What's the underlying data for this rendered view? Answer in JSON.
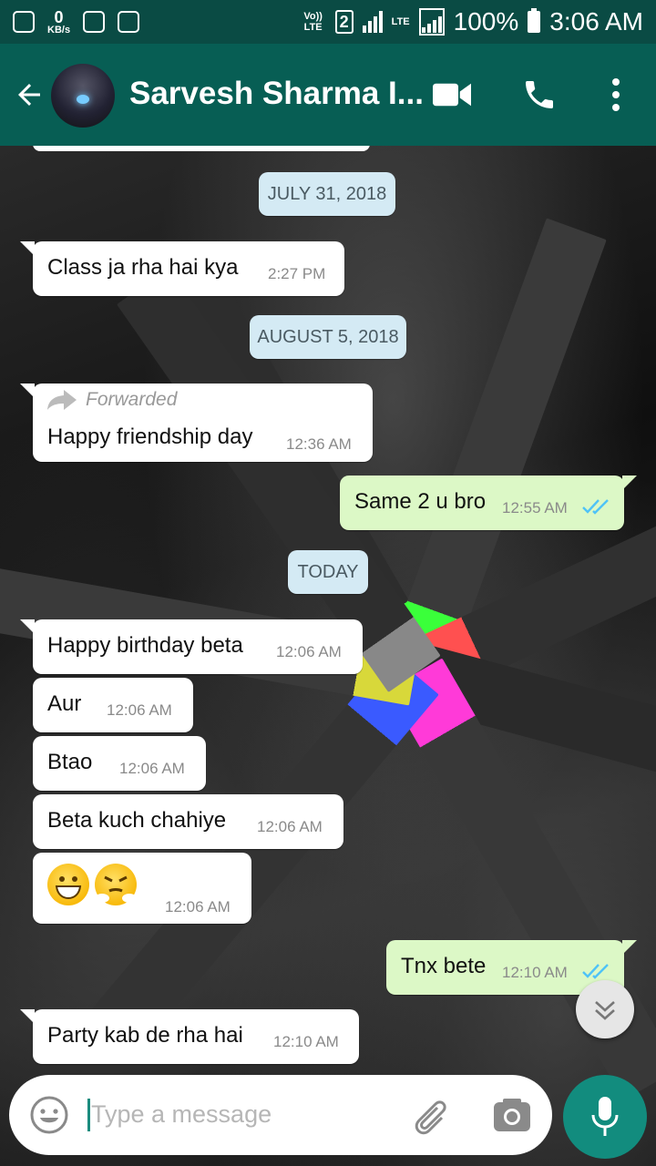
{
  "status_bar": {
    "data_speed_value": "0",
    "data_speed_unit": "KB/s",
    "volte": "Vo)) LTE",
    "sim": "2",
    "lte": "LTE",
    "battery": "100%",
    "time": "3:06 AM"
  },
  "header": {
    "contact_name": "Sarvesh Sharma I...",
    "back_icon": "arrow-left-icon",
    "video_icon": "videocam-icon",
    "call_icon": "phone-icon",
    "menu_icon": "more-vert-icon"
  },
  "messages": [
    {
      "type": "date",
      "text": "JULY 31, 2018"
    },
    {
      "type": "in",
      "text": "Class ja rha hai kya",
      "time": "2:27 PM"
    },
    {
      "type": "date",
      "text": "AUGUST 5, 2018"
    },
    {
      "type": "in",
      "forwarded_label": "Forwarded",
      "text": "Happy friendship day",
      "time": "12:36 AM"
    },
    {
      "type": "out",
      "text": "Same 2 u bro",
      "time": "12:55 AM",
      "status": "read"
    },
    {
      "type": "date",
      "text": "TODAY"
    },
    {
      "type": "in",
      "text": "Happy birthday beta",
      "time": "12:06 AM"
    },
    {
      "type": "in",
      "text": "Aur",
      "time": "12:06 AM"
    },
    {
      "type": "in",
      "text": "Btao",
      "time": "12:06 AM"
    },
    {
      "type": "in",
      "text": "Beta kuch chahiye",
      "time": "12:06 AM"
    },
    {
      "type": "in",
      "emoji": [
        "grinning-face-icon",
        "face-with-steam-icon"
      ],
      "time": "12:06 AM"
    },
    {
      "type": "out",
      "text": "Tnx bete",
      "time": "12:10 AM",
      "status": "read"
    },
    {
      "type": "in",
      "text": "Party kab de rha hai",
      "time": "12:10 AM"
    }
  ],
  "composer": {
    "placeholder": "Type a message",
    "emoji_icon": "smiley-icon",
    "attach_icon": "paperclip-icon",
    "camera_icon": "camera-icon",
    "mic_icon": "mic-icon"
  },
  "colors": {
    "status_bar": "#0a4b44",
    "header": "#075e54",
    "outgoing_bubble": "#dcf8c6",
    "incoming_bubble": "#ffffff",
    "date_chip": "#d4eaf4",
    "read_ticks": "#4fc3f7",
    "mic_button": "#128c7e"
  }
}
